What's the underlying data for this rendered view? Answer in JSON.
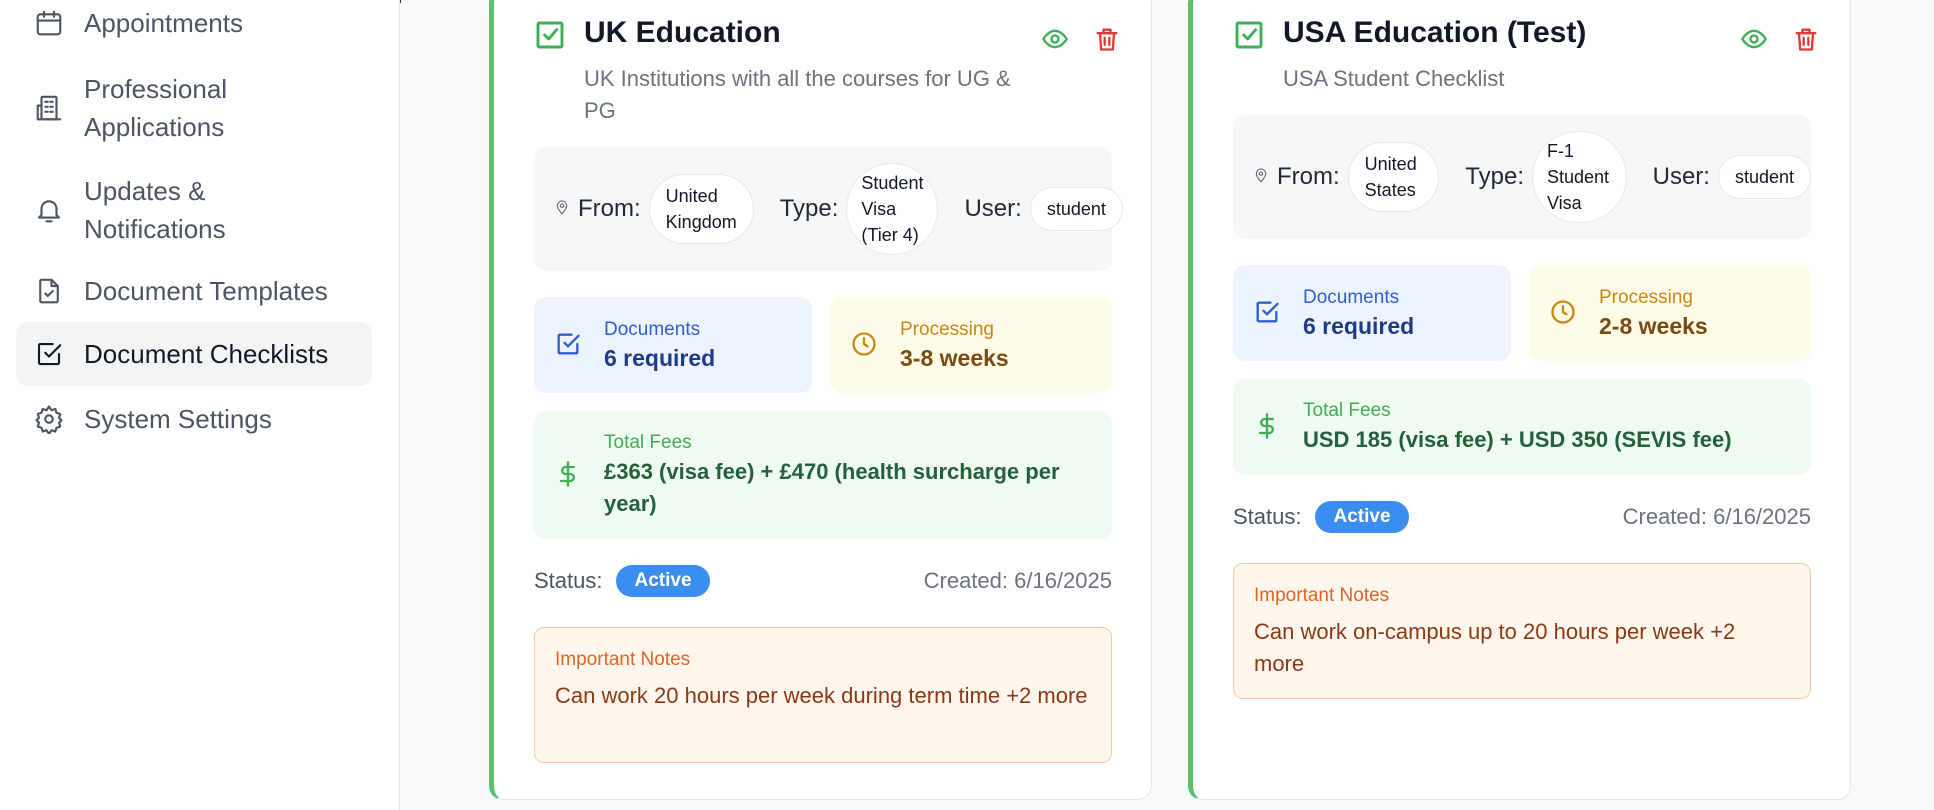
{
  "sidebar": {
    "items": [
      {
        "label": "Appointments",
        "icon": "calendar-icon"
      },
      {
        "label": "Professional Applications",
        "icon": "building-icon"
      },
      {
        "label": "Updates & Notifications",
        "icon": "bell-icon"
      },
      {
        "label": "Document Templates",
        "icon": "file-check-icon"
      },
      {
        "label": "Document Checklists",
        "icon": "check-square-icon",
        "active": true
      },
      {
        "label": "System Settings",
        "icon": "gear-icon"
      }
    ]
  },
  "cards": [
    {
      "title": "UK Education",
      "description": "UK Institutions with all the courses for UG & PG",
      "from_label": "From:",
      "from": "United Kingdom",
      "type_label": "Type:",
      "type": "Student Visa (Tier 4)",
      "user_label": "User:",
      "user": "student",
      "documents_label": "Documents",
      "documents": "6 required",
      "processing_label": "Processing",
      "processing": "3-8 weeks",
      "fees_label": "Total Fees",
      "fees": "£363 (visa fee) + £470 (health surcharge per year)",
      "status_label": "Status:",
      "status": "Active",
      "created": "Created: 6/16/2025",
      "notes_label": "Important Notes",
      "notes": "Can work 20 hours per week during term time +2 more"
    },
    {
      "title": "USA Education (Test)",
      "description": "USA Student Checklist",
      "from_label": "From:",
      "from": "United States",
      "type_label": "Type:",
      "type": "F-1 Student Visa",
      "user_label": "User:",
      "user": "student",
      "documents_label": "Documents",
      "documents": "6 required",
      "processing_label": "Processing",
      "processing": "2-8 weeks",
      "fees_label": "Total Fees",
      "fees": "USD 185 (visa fee) + USD 350 (SEVIS fee)",
      "status_label": "Status:",
      "status": "Active",
      "created": "Created: 6/16/2025",
      "notes_label": "Important Notes",
      "notes": "Can work on-campus up to 20 hours per week +2 more"
    }
  ],
  "colors": {
    "accent_green": "#5cbf6b",
    "badge_blue": "#3b8df0",
    "delete_red": "#dc3a3a"
  }
}
